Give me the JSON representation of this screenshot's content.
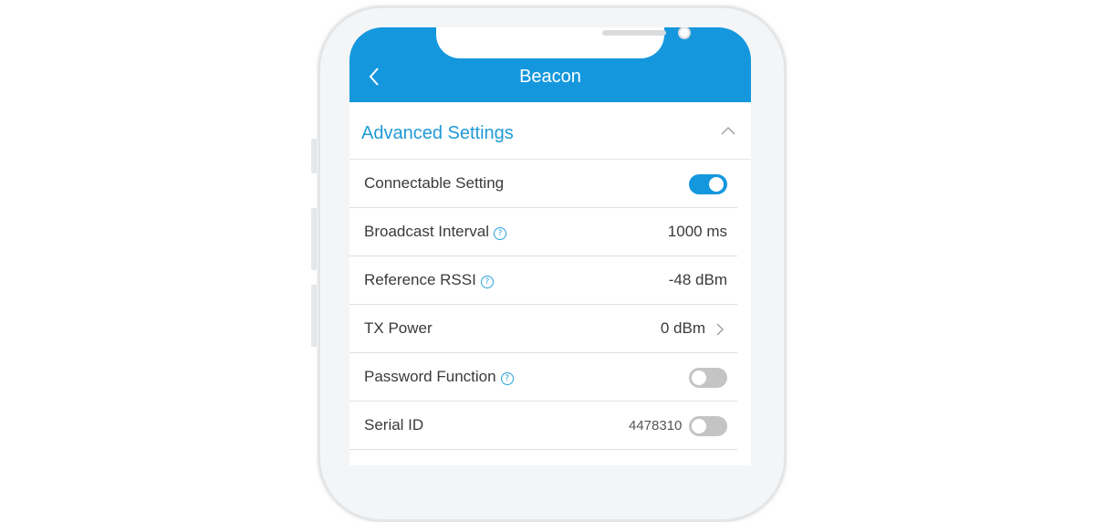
{
  "header": {
    "title": "Beacon"
  },
  "section": {
    "title": "Advanced Settings",
    "expanded": true
  },
  "settings": {
    "connectable": {
      "label": "Connectable Setting",
      "toggle_on": true
    },
    "broadcast_interval": {
      "label": "Broadcast Interval",
      "value": "1000 ms",
      "help": "?"
    },
    "reference_rssi": {
      "label": "Reference RSSI",
      "value": "-48 dBm",
      "help": "?"
    },
    "tx_power": {
      "label": "TX Power",
      "value": "0 dBm"
    },
    "password_function": {
      "label": "Password Function",
      "toggle_on": false,
      "help": "?"
    },
    "serial_id": {
      "label": "Serial ID",
      "value": "4478310",
      "toggle_on": false
    }
  },
  "colors": {
    "accent": "#1497dd",
    "section_title": "#1f9ad6",
    "toggle_off": "#c4c4c4"
  },
  "icons": [
    "back-chevron-icon",
    "chevron-up-icon",
    "help-icon",
    "chevron-right-icon"
  ]
}
